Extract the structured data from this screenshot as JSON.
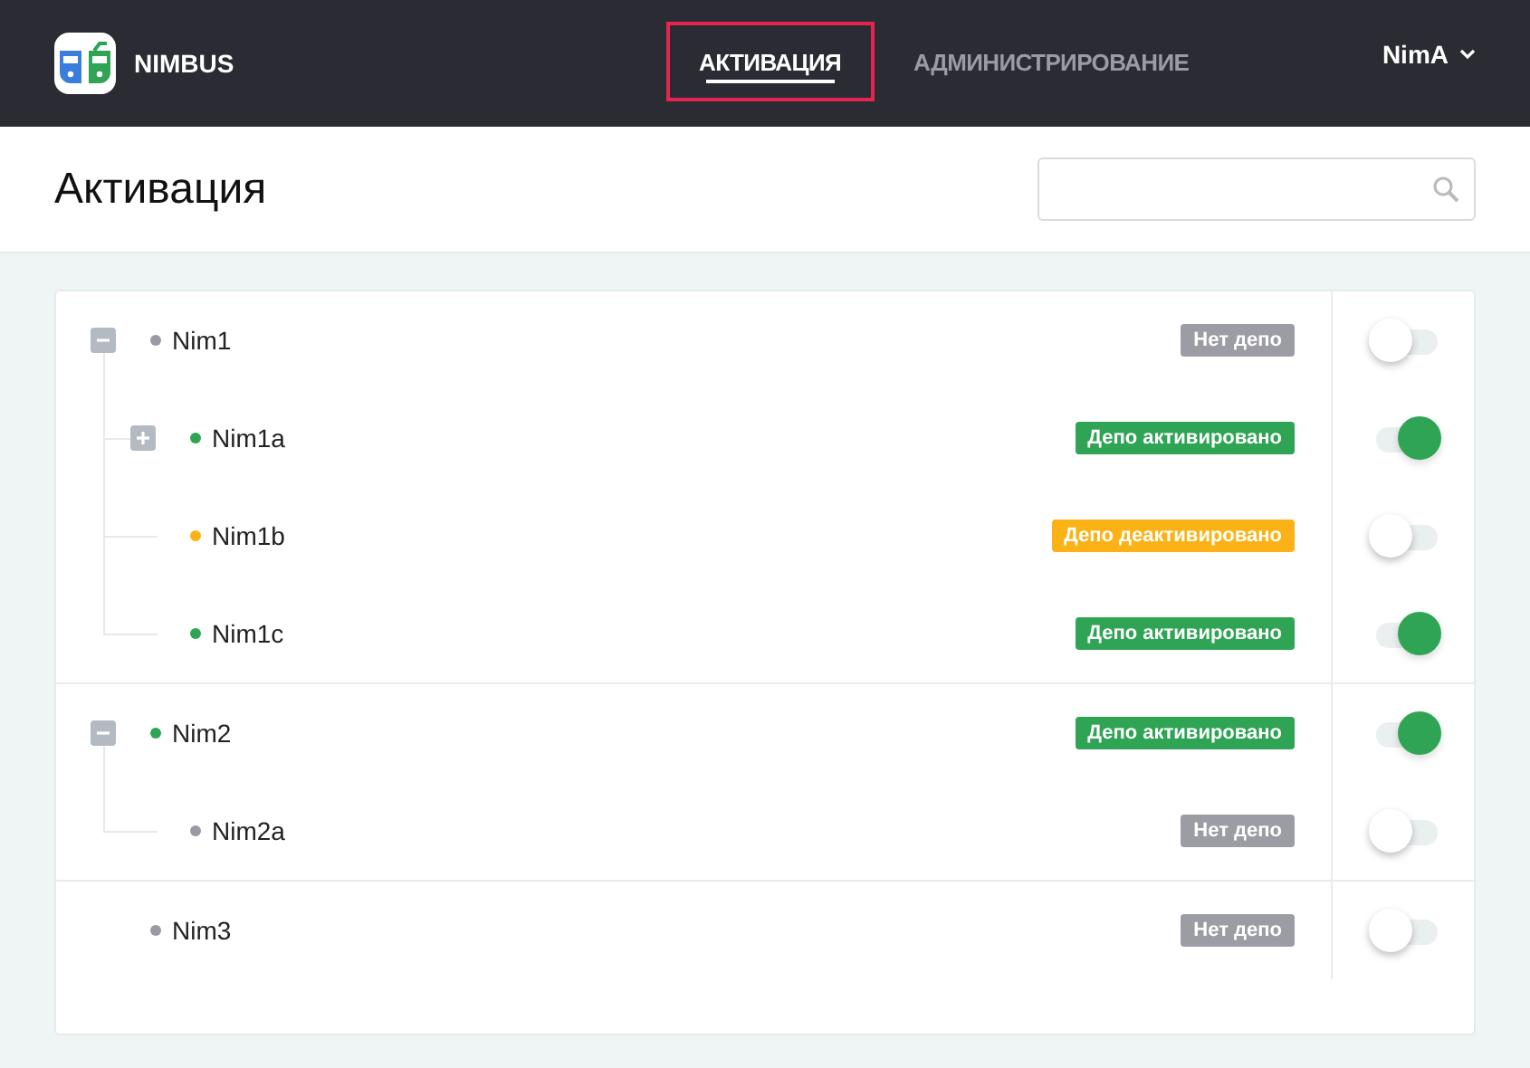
{
  "header": {
    "brand": "NIMBUS",
    "tabs": [
      {
        "label": "АКТИВАЦИЯ",
        "selected": true
      },
      {
        "label": "АДМИНИСТРИРОВАНИЕ",
        "selected": false
      }
    ],
    "user": "NimA"
  },
  "page": {
    "title": "Активация"
  },
  "tree": [
    {
      "name": "Nim1",
      "color": "#9a9aa2",
      "badge": {
        "text": "Нет депо",
        "kind": "none"
      },
      "on": false,
      "expanded": true,
      "children": [
        {
          "name": "Nim1a",
          "color": "#2ea454",
          "badge": {
            "text": "Депо активировано",
            "kind": "active"
          },
          "on": true,
          "expanded": false
        },
        {
          "name": "Nim1b",
          "color": "#fbb216",
          "badge": {
            "text": "Депо деактивировано",
            "kind": "inactive"
          },
          "on": false
        },
        {
          "name": "Nim1c",
          "color": "#2ea454",
          "badge": {
            "text": "Депо активировано",
            "kind": "active"
          },
          "on": true
        }
      ]
    },
    {
      "name": "Nim2",
      "color": "#2ea454",
      "badge": {
        "text": "Депо активировано",
        "kind": "active"
      },
      "on": true,
      "expanded": true,
      "children": [
        {
          "name": "Nim2a",
          "color": "#9a9aa2",
          "badge": {
            "text": "Нет депо",
            "kind": "none"
          },
          "on": false
        }
      ]
    },
    {
      "name": "Nim3",
      "color": "#9a9aa2",
      "badge": {
        "text": "Нет депо",
        "kind": "none"
      },
      "on": false
    }
  ]
}
